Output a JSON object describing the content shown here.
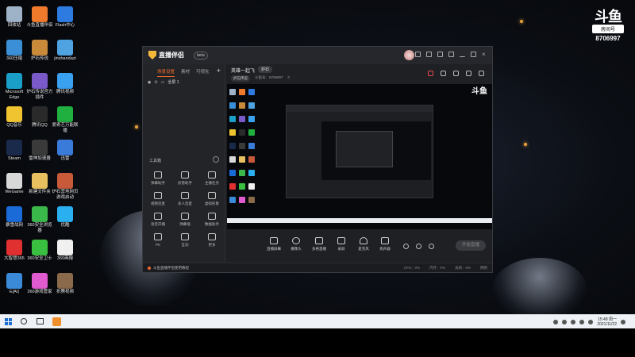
{
  "watermark": {
    "brand": "斗鱼",
    "room_label": "房间号",
    "room_number": "8706997"
  },
  "desktop_icons": [
    {
      "label": "回收站",
      "color": "#9fb3c8"
    },
    {
      "label": "斗鱼直播伴侣",
      "color": "#f07a2c"
    },
    {
      "label": "Flash中心",
      "color": "#2d7be0"
    },
    {
      "label": "360压缩",
      "color": "#3a8fd6"
    },
    {
      "label": "炉石传说",
      "color": "#c98a3a"
    },
    {
      "label": "jinshandazi",
      "color": "#4fa3e0"
    },
    {
      "label": "Microsoft Edge",
      "color": "#1aa0c8"
    },
    {
      "label": "炉石传说官方插件",
      "color": "#7a5ac8"
    },
    {
      "label": "腾讯视频",
      "color": "#3aa0f0"
    },
    {
      "label": "QQ音乐",
      "color": "#f0c430"
    },
    {
      "label": "腾讯QQ",
      "color": "#2a2a2a"
    },
    {
      "label": "爱奇艺万能联播",
      "color": "#20b040"
    },
    {
      "label": "Steam",
      "color": "#1a2a4a"
    },
    {
      "label": "雷神加速器",
      "color": "#3a3a3a"
    },
    {
      "label": "迅雷",
      "color": "#3a7ad8"
    },
    {
      "label": "WeGame",
      "color": "#d8d8d8"
    },
    {
      "label": "新建文件夹",
      "color": "#e8c060"
    },
    {
      "label": "炉石营地网页游戏启动",
      "color": "#c85a3a"
    },
    {
      "label": "暴雪战网",
      "color": "#1a6ad8"
    },
    {
      "label": "360安全浏览器",
      "color": "#3ab84a"
    },
    {
      "label": "优酷",
      "color": "#2ab0f0"
    },
    {
      "label": "大智慧365",
      "color": "#e03030"
    },
    {
      "label": "360安全卫士",
      "color": "#3ac040"
    },
    {
      "label": "360画报",
      "color": "#f0f0f0"
    },
    {
      "label": "E[AI]",
      "color": "#3a8ad8"
    },
    {
      "label": "360游戏管家",
      "color": "#e05ad0"
    },
    {
      "label": "折腾视频",
      "color": "#8a6a4a"
    }
  ],
  "app": {
    "name": "直播伴侣",
    "version": "beta",
    "left_tabs": [
      "场景设置",
      "素材",
      "可视化"
    ],
    "scene_name": "全屏 1",
    "tools_title": "工具箱",
    "tools": [
      "弹幕助手",
      "房管助手",
      "主播任务",
      "视频连麦",
      "多人连麦",
      "虚拟形象",
      "语音开播",
      "弹幕墙",
      "数据助手",
      "PK",
      "互动",
      "更多"
    ],
    "room_title": "英雄一起飞",
    "category": "炉石",
    "meta_chip": "炉石传说",
    "meta_room": "斗鱼号：8706997",
    "meta_extra": "0",
    "controls": [
      "直播屏幕",
      "摄像头",
      "多格直播",
      "录屏",
      "麦克风",
      "扬声器"
    ],
    "go_live": "开始直播",
    "status_tip": "斗鱼直播伴侣使用教程",
    "stats": [
      "CPU：0%",
      "内存：0%",
      "丢帧：0%",
      "网络"
    ]
  },
  "taskbar": {
    "time": "15:48 周一",
    "date": "2021/11/22"
  }
}
